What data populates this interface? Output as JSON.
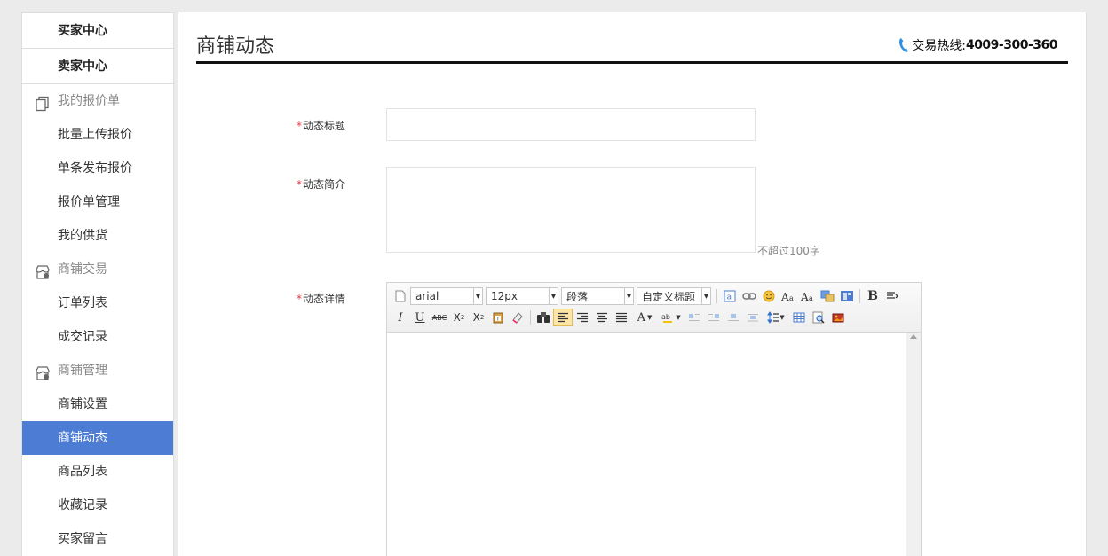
{
  "sidebar": {
    "buyer_center": "买家中心",
    "seller_center": "卖家中心",
    "groups": [
      {
        "label": "我的报价单",
        "icon": "quote-doc-icon",
        "items": [
          "批量上传报价",
          "单条发布报价",
          "报价单管理",
          "我的供货"
        ]
      },
      {
        "label": "商铺交易",
        "icon": "shop-icon",
        "items": [
          "订单列表",
          "成交记录"
        ]
      },
      {
        "label": "商铺管理",
        "icon": "shop-icon",
        "items": [
          "商铺设置",
          "商铺动态",
          "商品列表",
          "收藏记录",
          "买家留言"
        ]
      }
    ],
    "active_item": "商铺动态"
  },
  "header": {
    "title": "商铺动态",
    "hotline_label": "交易热线:",
    "hotline_number": "4009-300-360"
  },
  "form": {
    "title_label": "动态标题",
    "intro_label": "动态简介",
    "intro_hint": "不超过100字",
    "detail_label": "动态详情",
    "required_mark": "*",
    "title_value": "",
    "intro_value": ""
  },
  "editor": {
    "font_family": "arial",
    "font_size": "12px",
    "paragraph": "段落",
    "custom_heading": "自定义标题"
  },
  "colors": {
    "accent": "#4c7cd4",
    "required": "#e4393c",
    "phone_icon": "#2f8fe0"
  }
}
